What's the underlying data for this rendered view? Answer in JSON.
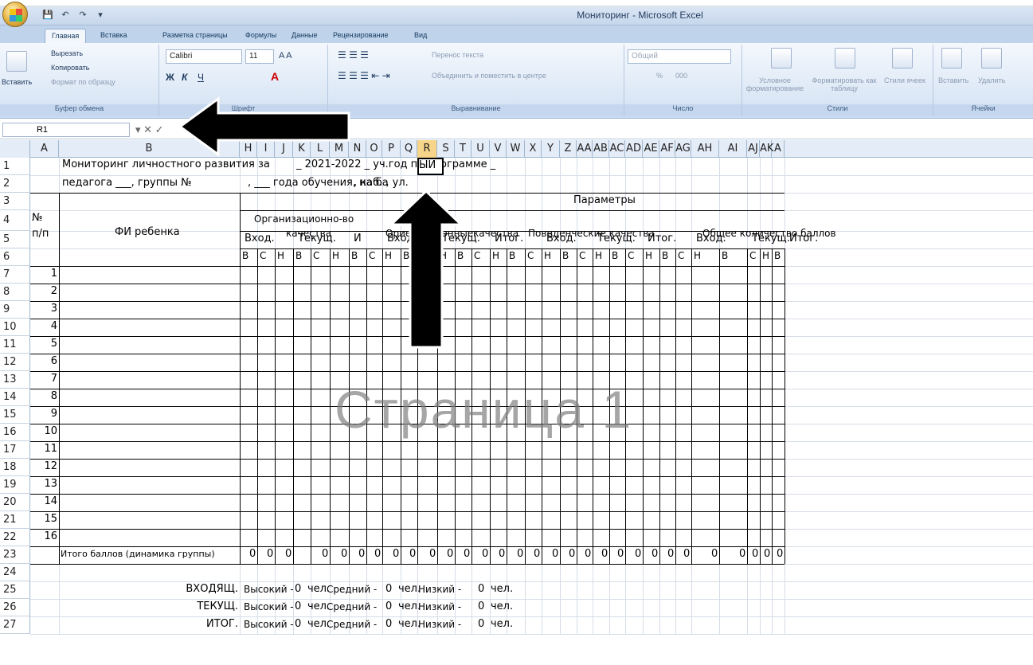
{
  "window": {
    "title": "Мониторинг - Microsoft Excel"
  },
  "tabs": [
    "Главная",
    "Вставка",
    "Разметка страницы",
    "Формулы",
    "Данные",
    "Рецензирование",
    "Вид"
  ],
  "ribbon": {
    "clipboard": {
      "label": "Буфер обмена",
      "paste": "Вставить",
      "cut": "Вырезать",
      "copy": "Копировать",
      "format_painter": "Формат по образцу"
    },
    "font": {
      "label": "Шрифт",
      "name": "Calibri",
      "size": "11",
      "bold": "Ж",
      "italic": "К",
      "underline": "Ч"
    },
    "alignment": {
      "label": "Выравнивание",
      "wrap": "Перенос текста",
      "merge": "Объединить и поместить в центре"
    },
    "number": {
      "label": "Число",
      "format": "Общий",
      "percent": "%",
      "thousands": "000"
    },
    "styles": {
      "label": "Стили",
      "conditional": "Условное форматирование",
      "table": "Форматировать как таблицу",
      "cell_styles": "Стили ячеек"
    },
    "cells": {
      "label": "Ячейки",
      "insert": "Вставить",
      "delete": "Удалить"
    }
  },
  "formula_bar": {
    "namebox": "R1",
    "value": ""
  },
  "columns": [
    {
      "label": "A",
      "w": 36
    },
    {
      "label": "B",
      "w": 227
    },
    {
      "label": "H",
      "w": 22
    },
    {
      "label": "I",
      "w": 22
    },
    {
      "label": "J",
      "w": 23
    },
    {
      "label": "K",
      "w": 22
    },
    {
      "label": "L",
      "w": 24
    },
    {
      "label": "M",
      "w": 24
    },
    {
      "label": "N",
      "w": 22
    },
    {
      "label": "O",
      "w": 20
    },
    {
      "label": "P",
      "w": 23
    },
    {
      "label": "Q",
      "w": 21
    },
    {
      "label": "R",
      "w": 25
    },
    {
      "label": "S",
      "w": 22
    },
    {
      "label": "T",
      "w": 21
    },
    {
      "label": "U",
      "w": 23
    },
    {
      "label": "V",
      "w": 21
    },
    {
      "label": "W",
      "w": 23
    },
    {
      "label": "X",
      "w": 21
    },
    {
      "label": "Y",
      "w": 23
    },
    {
      "label": "Z",
      "w": 21
    },
    {
      "label": "AA",
      "w": 20
    },
    {
      "label": "AB",
      "w": 21
    },
    {
      "label": "AC",
      "w": 20
    },
    {
      "label": "AD",
      "w": 22
    },
    {
      "label": "AE",
      "w": 21
    },
    {
      "label": "AF",
      "w": 20
    },
    {
      "label": "AG",
      "w": 20
    },
    {
      "label": "AH",
      "w": 35
    },
    {
      "label": "AI",
      "w": 35
    },
    {
      "label": "AJ",
      "w": 16
    },
    {
      "label": "AK",
      "w": 15
    },
    {
      "label": "A",
      "w": 16
    }
  ],
  "rows": [
    "1",
    "2",
    "3",
    "4",
    "5",
    "6",
    "7",
    "8",
    "9",
    "10",
    "11",
    "12",
    "13",
    "14",
    "15",
    "16",
    "17",
    "18",
    "19",
    "20",
    "21",
    "22",
    "23",
    "24",
    "25",
    "26",
    "27"
  ],
  "sheet": {
    "r1": {
      "text1": "Мониторинг личностного развития за",
      "text2": "_ 2021-2022 _ уч.год по программе _",
      "r1_value": "ЫЙ"
    },
    "r2": {
      "text1": "педагога ___, группы №",
      "text2": ", ___ года обучения, на ба",
      "text3": ", каб. , ул."
    },
    "params": "Параметры",
    "num_header_1": "№",
    "num_header_2": "п/п",
    "name_header": "ФИ ребенка",
    "groups": [
      "Организационно-во",
      "качества",
      "Ориентационные",
      "качества",
      "Поведенческие качества",
      "Общее количество баллов"
    ],
    "phases": [
      "Вход.",
      "Текущ.",
      "И",
      "Вход.",
      "Текущ.",
      "Итог.",
      "Вход.",
      "Текущ.",
      "Итог.",
      "Вход.",
      "Текущ.",
      "Итог."
    ],
    "levels": [
      "В",
      "С",
      "Н"
    ],
    "children": [
      "1",
      "2",
      "3",
      "4",
      "5",
      "6",
      "7",
      "8",
      "9",
      "10",
      "11",
      "12",
      "13",
      "14",
      "15",
      "16"
    ],
    "total_label": "Итого баллов (динамика группы)",
    "total_value": "0",
    "summary": [
      {
        "label": "ВХОДЯЩ.",
        "high": "Высокий -",
        "mid": "Средний -",
        "low": "Низкий -",
        "count": "0",
        "unit": "чел."
      },
      {
        "label": "ТЕКУЩ.",
        "high": "Высокий -",
        "mid": "Средний -",
        "low": "Низкий -",
        "count": "0",
        "unit": "чел."
      },
      {
        "label": "ИТОГ.",
        "high": "Высокий -",
        "mid": "Средний -",
        "low": "Низкий -",
        "count": "0",
        "unit": "чел."
      }
    ],
    "watermark": "Страница 1"
  }
}
